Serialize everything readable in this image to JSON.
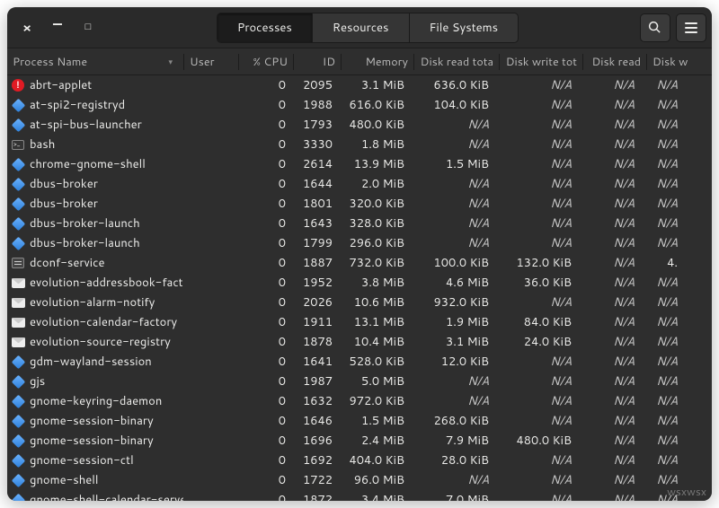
{
  "tabs": {
    "processes": "Processes",
    "resources": "Resources",
    "filesystems": "File Systems",
    "active": "processes"
  },
  "columns": {
    "name": "Process Name",
    "user": "User",
    "cpu": "% CPU",
    "id": "ID",
    "memory": "Memory",
    "disk_read_total": "Disk read tota",
    "disk_write_total": "Disk write tot",
    "disk_read": "Disk read",
    "disk_write": "Disk w"
  },
  "na": "N/A",
  "processes": [
    {
      "icon": "exclaim",
      "name": "abrt-applet",
      "cpu": "0",
      "id": "2095",
      "mem": "3.1 MiB",
      "drt": "636.0 KiB",
      "dwt": "N/A",
      "dr": "N/A",
      "dw": "N/A"
    },
    {
      "icon": "diamond",
      "name": "at-spi2-registryd",
      "cpu": "0",
      "id": "1988",
      "mem": "616.0 KiB",
      "drt": "104.0 KiB",
      "dwt": "N/A",
      "dr": "N/A",
      "dw": "N/A"
    },
    {
      "icon": "diamond",
      "name": "at-spi-bus-launcher",
      "cpu": "0",
      "id": "1793",
      "mem": "480.0 KiB",
      "drt": "N/A",
      "dwt": "N/A",
      "dr": "N/A",
      "dw": "N/A"
    },
    {
      "icon": "term",
      "name": "bash",
      "cpu": "0",
      "id": "3330",
      "mem": "1.8 MiB",
      "drt": "N/A",
      "dwt": "N/A",
      "dr": "N/A",
      "dw": "N/A"
    },
    {
      "icon": "diamond",
      "name": "chrome-gnome-shell",
      "cpu": "0",
      "id": "2614",
      "mem": "13.9 MiB",
      "drt": "1.5 MiB",
      "dwt": "N/A",
      "dr": "N/A",
      "dw": "N/A"
    },
    {
      "icon": "diamond",
      "name": "dbus-broker",
      "cpu": "0",
      "id": "1644",
      "mem": "2.0 MiB",
      "drt": "N/A",
      "dwt": "N/A",
      "dr": "N/A",
      "dw": "N/A"
    },
    {
      "icon": "diamond",
      "name": "dbus-broker",
      "cpu": "0",
      "id": "1801",
      "mem": "320.0 KiB",
      "drt": "N/A",
      "dwt": "N/A",
      "dr": "N/A",
      "dw": "N/A"
    },
    {
      "icon": "diamond",
      "name": "dbus-broker-launch",
      "cpu": "0",
      "id": "1643",
      "mem": "328.0 KiB",
      "drt": "N/A",
      "dwt": "N/A",
      "dr": "N/A",
      "dw": "N/A"
    },
    {
      "icon": "diamond",
      "name": "dbus-broker-launch",
      "cpu": "0",
      "id": "1799",
      "mem": "296.0 KiB",
      "drt": "N/A",
      "dwt": "N/A",
      "dr": "N/A",
      "dw": "N/A"
    },
    {
      "icon": "sliders",
      "name": "dconf-service",
      "cpu": "0",
      "id": "1887",
      "mem": "732.0 KiB",
      "drt": "100.0 KiB",
      "dwt": "132.0 KiB",
      "dr": "N/A",
      "dw": "4."
    },
    {
      "icon": "envelope",
      "name": "evolution-addressbook-factory",
      "cpu": "0",
      "id": "1952",
      "mem": "3.8 MiB",
      "drt": "4.6 MiB",
      "dwt": "36.0 KiB",
      "dr": "N/A",
      "dw": "N/A"
    },
    {
      "icon": "envelope",
      "name": "evolution-alarm-notify",
      "cpu": "0",
      "id": "2026",
      "mem": "10.6 MiB",
      "drt": "932.0 KiB",
      "dwt": "N/A",
      "dr": "N/A",
      "dw": "N/A"
    },
    {
      "icon": "envelope",
      "name": "evolution-calendar-factory",
      "cpu": "0",
      "id": "1911",
      "mem": "13.1 MiB",
      "drt": "1.9 MiB",
      "dwt": "84.0 KiB",
      "dr": "N/A",
      "dw": "N/A"
    },
    {
      "icon": "envelope",
      "name": "evolution-source-registry",
      "cpu": "0",
      "id": "1878",
      "mem": "10.4 MiB",
      "drt": "3.1 MiB",
      "dwt": "24.0 KiB",
      "dr": "N/A",
      "dw": "N/A"
    },
    {
      "icon": "diamond",
      "name": "gdm-wayland-session",
      "cpu": "0",
      "id": "1641",
      "mem": "528.0 KiB",
      "drt": "12.0 KiB",
      "dwt": "N/A",
      "dr": "N/A",
      "dw": "N/A"
    },
    {
      "icon": "diamond",
      "name": "gjs",
      "cpu": "0",
      "id": "1987",
      "mem": "5.0 MiB",
      "drt": "N/A",
      "dwt": "N/A",
      "dr": "N/A",
      "dw": "N/A"
    },
    {
      "icon": "diamond",
      "name": "gnome-keyring-daemon",
      "cpu": "0",
      "id": "1632",
      "mem": "972.0 KiB",
      "drt": "N/A",
      "dwt": "N/A",
      "dr": "N/A",
      "dw": "N/A"
    },
    {
      "icon": "diamond",
      "name": "gnome-session-binary",
      "cpu": "0",
      "id": "1646",
      "mem": "1.5 MiB",
      "drt": "268.0 KiB",
      "dwt": "N/A",
      "dr": "N/A",
      "dw": "N/A"
    },
    {
      "icon": "diamond",
      "name": "gnome-session-binary",
      "cpu": "0",
      "id": "1696",
      "mem": "2.4 MiB",
      "drt": "7.9 MiB",
      "dwt": "480.0 KiB",
      "dr": "N/A",
      "dw": "N/A"
    },
    {
      "icon": "diamond",
      "name": "gnome-session-ctl",
      "cpu": "0",
      "id": "1692",
      "mem": "404.0 KiB",
      "drt": "28.0 KiB",
      "dwt": "N/A",
      "dr": "N/A",
      "dw": "N/A"
    },
    {
      "icon": "diamond",
      "name": "gnome-shell",
      "cpu": "0",
      "id": "1722",
      "mem": "96.0 MiB",
      "drt": "N/A",
      "dwt": "N/A",
      "dr": "N/A",
      "dw": "N/A"
    },
    {
      "icon": "diamond",
      "name": "gnome-shell-calendar-server",
      "cpu": "0",
      "id": "1872",
      "mem": "3.4 MiB",
      "drt": "7.0 MiB",
      "dwt": "N/A",
      "dr": "N/A",
      "dw": "N/A"
    }
  ],
  "watermark": "wsxwsx"
}
